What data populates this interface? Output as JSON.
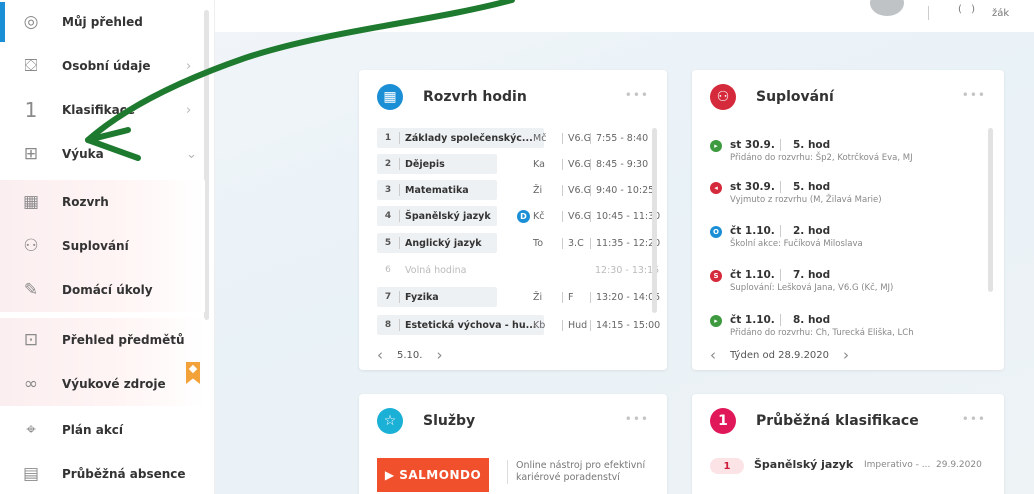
{
  "sidebar": {
    "items": [
      {
        "label": "Můj přehled",
        "icon": "dashboard-icon",
        "glyph": "◎",
        "chevron": ""
      },
      {
        "label": "Osobní údaje",
        "icon": "person-card-icon",
        "glyph": "⛋",
        "chevron": "›"
      },
      {
        "label": "Klasifikace",
        "icon": "grade-one-icon",
        "glyph": "1",
        "chevron": "›"
      },
      {
        "label": "Výuka",
        "icon": "teaching-icon",
        "glyph": "⊞",
        "chevron": "⌄"
      },
      {
        "label": "Rozvrh",
        "icon": "timetable-icon",
        "glyph": "▦",
        "chevron": ""
      },
      {
        "label": "Suplování",
        "icon": "substitution-icon",
        "glyph": "⚇",
        "chevron": ""
      },
      {
        "label": "Domácí úkoly",
        "icon": "homework-icon",
        "glyph": "✎",
        "chevron": ""
      },
      {
        "label": "Přehled předmětů",
        "icon": "subjects-icon",
        "glyph": "⊡",
        "chevron": ""
      },
      {
        "label": "Výukové zdroje",
        "icon": "link-icon",
        "glyph": "∞",
        "chevron": ""
      },
      {
        "label": "Plán akcí",
        "icon": "map-pin-icon",
        "glyph": "⌖",
        "chevron": ""
      },
      {
        "label": "Průběžná absence",
        "icon": "absence-icon",
        "glyph": "▤",
        "chevron": ""
      }
    ]
  },
  "topbar": {
    "user_icon_glyph": "( )",
    "user_label": "žák"
  },
  "rozvrh": {
    "title": "Rozvrh hodin",
    "dots": "•••",
    "rows": [
      {
        "num": "1",
        "subject": "Základy společenskýc...",
        "teacher": "Mč",
        "room": "V6.G",
        "time": "7:55 - 8:40",
        "badge": "",
        "free": false
      },
      {
        "num": "2",
        "subject": "Dějepis",
        "teacher": "Ka",
        "room": "V6.G",
        "time": "8:45 - 9:30",
        "badge": "",
        "free": false
      },
      {
        "num": "3",
        "subject": "Matematika",
        "teacher": "Ži",
        "room": "V6.G",
        "time": "9:40 - 10:25",
        "badge": "",
        "free": false
      },
      {
        "num": "4",
        "subject": "Španělský jazyk",
        "teacher": "Kč",
        "room": "V6.G",
        "time": "10:45 - 11:30",
        "badge": "D",
        "free": false
      },
      {
        "num": "5",
        "subject": "Anglický jazyk",
        "teacher": "To",
        "room": "3.C",
        "time": "11:35 - 12:20",
        "badge": "",
        "free": false
      },
      {
        "num": "6",
        "subject": "Volná hodina",
        "teacher": "",
        "room": "",
        "time": "12:30 - 13:15",
        "badge": "",
        "free": true
      },
      {
        "num": "7",
        "subject": "Fyzika",
        "teacher": "Ži",
        "room": "F",
        "time": "13:20 - 14:05",
        "badge": "",
        "free": false
      },
      {
        "num": "8",
        "subject": "Estetická výchova - hu...",
        "teacher": "Kb",
        "room": "Hud",
        "time": "14:15 - 15:00",
        "badge": "",
        "free": false
      }
    ],
    "footer_date": "5.10."
  },
  "suplovani": {
    "title": "Suplování",
    "dots": "•••",
    "rows": [
      {
        "day": "st  30.9.",
        "hour": "5. hod",
        "note": "Přidáno do rozvrhu: Šp2, Kotrčková Eva, MJ",
        "dot": "▸",
        "color": "#3d9a3f"
      },
      {
        "day": "st  30.9.",
        "hour": "5. hod",
        "note": "Vyjmuto z rozvrhu (M, Žilavá Marie)",
        "dot": "◂",
        "color": "#d42a3b"
      },
      {
        "day": "čt  1.10.",
        "hour": "2. hod",
        "note": "Školní akce: Fučíková Miloslava",
        "dot": "O",
        "color": "#1b8fd6"
      },
      {
        "day": "čt  1.10.",
        "hour": "7. hod",
        "note": "Suplování: Lešková Jana, V6.G (Kč, MJ)",
        "dot": "S",
        "color": "#d42a3b"
      },
      {
        "day": "čt  1.10.",
        "hour": "8. hod",
        "note": "Přidáno do rozvrhu: Ch, Turecká Eliška, LCh",
        "dot": "▸",
        "color": "#3d9a3f"
      }
    ],
    "footer_week": "Týden od 28.9.2020"
  },
  "sluzby": {
    "title": "Služby",
    "dots": "•••",
    "brand": "▶ SALMONDO",
    "desc_line1": "Online nástroj pro efektivní",
    "desc_line2": "kariérové poradenství"
  },
  "klasifikace": {
    "title": "Průběžná klasifikace",
    "dots": "•••",
    "icon_glyph": "1",
    "grade": "1",
    "subject": "Španělský jazyk",
    "desc": "Imperativo - ...",
    "date": "29.9.2020"
  },
  "colors": {
    "accent": "#1b8fd6",
    "danger": "#d42a3b",
    "brand_salmondo": "#f0502c",
    "annotation_arrow": "#1e7a2e"
  }
}
